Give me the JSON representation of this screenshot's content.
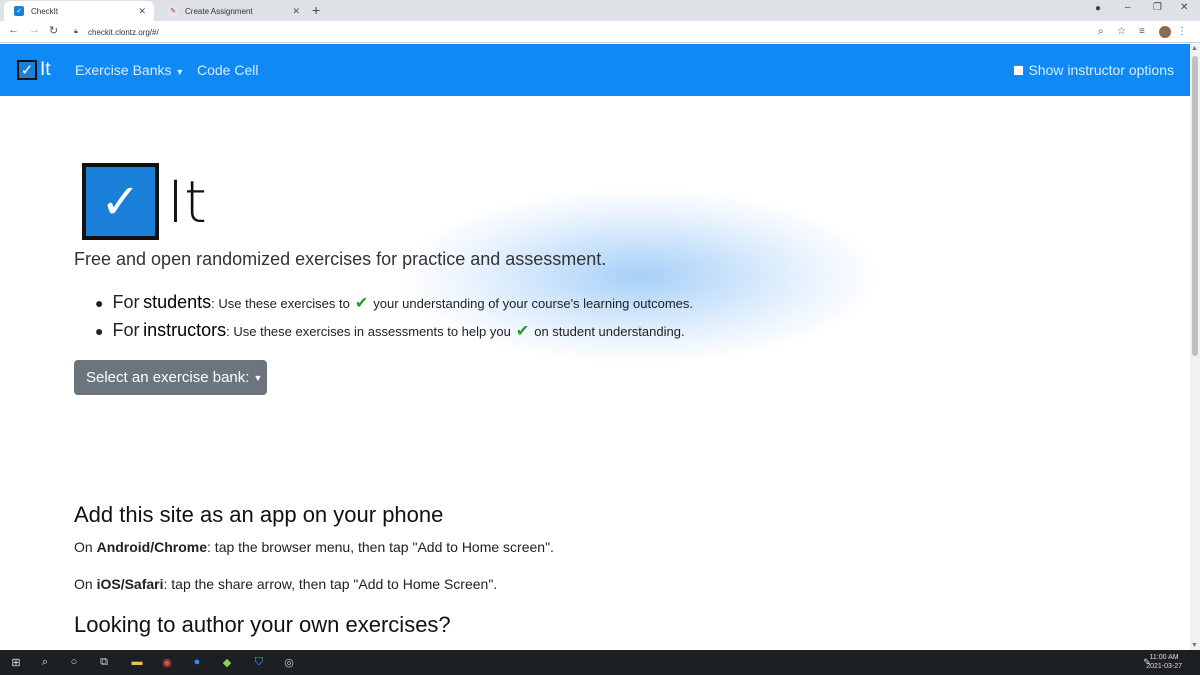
{
  "browser": {
    "tabs": [
      {
        "label": "CheckIt",
        "active": true
      },
      {
        "label": "Create Assignment",
        "active": false
      }
    ],
    "url": "checkit.clontz.org/#/"
  },
  "navbar": {
    "brand": "It",
    "links": [
      "Exercise Banks",
      "Code Cell"
    ],
    "instructor_toggle": "Show instructor options",
    "color": "#0e89f5"
  },
  "hero": {
    "logo_text": "It",
    "tagline": "Free and open randomized exercises for practice and assessment.",
    "bullets": [
      {
        "prefix": "For ",
        "role": "students",
        "before": ": Use these exercises to ",
        "after": " your understanding of your course's learning outcomes."
      },
      {
        "prefix": "For ",
        "role": "instructors",
        "before": ": Use these exercises in assessments to help you ",
        "after": " on student understanding."
      }
    ],
    "select_button": "Select an exercise bank:"
  },
  "content": {
    "app_heading": "Add this site as an app on your phone",
    "android": {
      "bold": "Android/Chrome",
      "text": ": tap the browser menu, then tap \"Add to Home screen\"."
    },
    "ios": {
      "bold": "iOS/Safari",
      "text": ": tap the share arrow, then tap \"Add to Home Screen\"."
    },
    "author_heading": "Looking to author your own exercises?"
  },
  "taskbar": {
    "time": "11:00 AM",
    "date": "2021-03-27"
  }
}
